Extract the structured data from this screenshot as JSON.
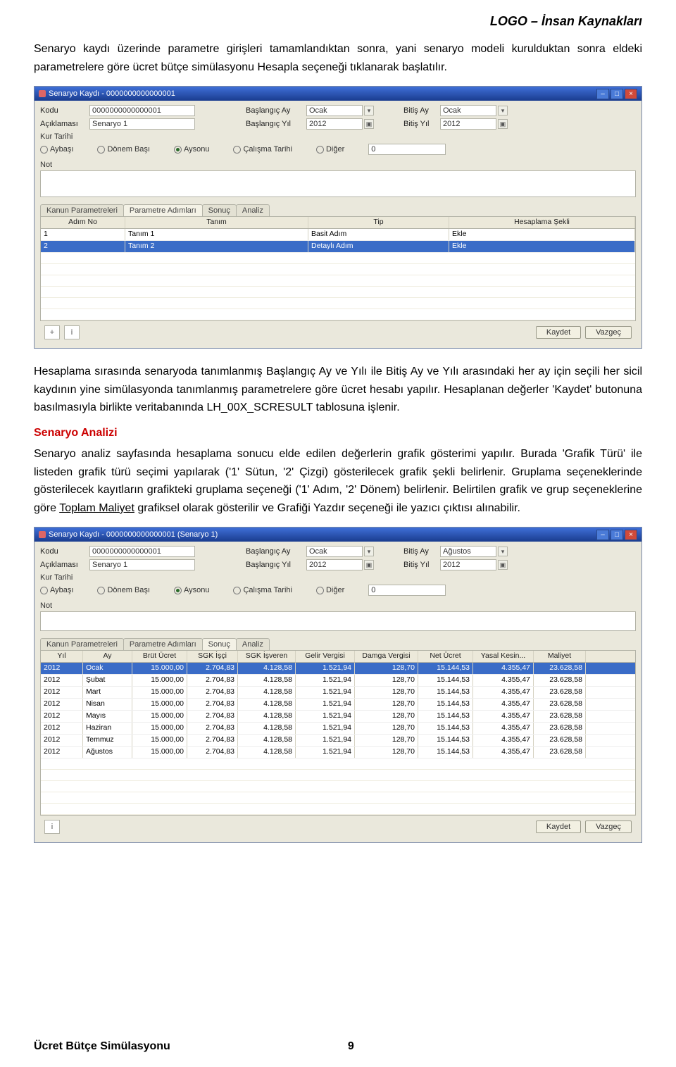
{
  "header": {
    "brand": "LOGO – İnsan Kaynakları"
  },
  "para1": "Senaryo kaydı üzerinde parametre girişleri tamamlandıktan sonra, yani senaryo modeli kurulduktan sonra eldeki parametrelere göre ücret bütçe simülasyonu Hesapla seçeneği tıklanarak başlatılır.",
  "win1": {
    "title": "Senaryo Kaydı - 0000000000000001",
    "fields": {
      "kodu_lbl": "Kodu",
      "kodu_val": "0000000000000001",
      "aciklamasi_lbl": "Açıklaması",
      "aciklamasi_val": "Senaryo 1",
      "bas_ay_lbl": "Başlangıç Ay",
      "bas_ay_val": "Ocak",
      "bas_yil_lbl": "Başlangıç Yıl",
      "bas_yil_val": "2012",
      "bitis_ay_lbl": "Bitiş Ay",
      "bitis_ay_val": "Ocak",
      "bitis_yil_lbl": "Bitiş Yıl",
      "bitis_yil_val": "2012",
      "kur_lbl": "Kur Tarihi",
      "deger_lbl": "",
      "deger_val": "0"
    },
    "radios": {
      "aybasi": "Aybaşı",
      "donem": "Dönem Başı",
      "aysonu": "Aysonu",
      "calisma": "Çalışma Tarihi",
      "diger": "Diğer"
    },
    "not_lbl": "Not",
    "tabs": [
      "Kanun Parametreleri",
      "Parametre Adımları",
      "Sonuç",
      "Analiz"
    ],
    "grid": {
      "cols": [
        "Adım No",
        "Tanım",
        "Tip",
        "Hesaplama Şekli"
      ],
      "rows": [
        {
          "no": "1",
          "tanim": "Tanım 1",
          "tip": "Basit Adım",
          "hes": "Ekle"
        },
        {
          "no": "2",
          "tanim": "Tanım 2",
          "tip": "Detaylı Adım",
          "hes": "Ekle"
        }
      ]
    },
    "buttons": {
      "kaydet": "Kaydet",
      "vazgec": "Vazgeç"
    }
  },
  "para2": "Hesaplama sırasında senaryoda tanımlanmış Başlangıç Ay ve Yılı ile Bitiş Ay ve Yılı arasındaki her ay için seçili her sicil kaydının yine simülasyonda tanımlanmış parametrelere göre ücret hesabı yapılır. Hesaplanan değerler 'Kaydet' butonuna basılmasıyla birlikte veritabanında LH_00X_SCRESULT tablosuna işlenir.",
  "section_title": "Senaryo Analizi",
  "para3_a": "Senaryo analiz sayfasında hesaplama sonucu elde edilen değerlerin grafik gösterimi yapılır. Burada 'Grafik Türü' ile listeden grafik türü seçimi yapılarak ('1' Sütun, '2' Çizgi) gösterilecek grafik şekli belirlenir. Gruplama seçeneklerinde gösterilecek kayıtların grafikteki gruplama seçeneği    ('1' Adım, '2' Dönem) belirlenir. Belirtilen grafik ve grup seçeneklerine göre ",
  "para3_u": "Toplam Maliyet",
  "para3_b": " grafiksel olarak gösterilir ve Grafiği Yazdır seçeneği ile yazıcı çıktısı alınabilir.",
  "win2": {
    "title": "Senaryo Kaydı - 0000000000000001 (Senaryo 1)",
    "fields": {
      "kodu_lbl": "Kodu",
      "kodu_val": "0000000000000001",
      "aciklamasi_lbl": "Açıklaması",
      "aciklamasi_val": "Senaryo 1",
      "bas_ay_lbl": "Başlangıç Ay",
      "bas_ay_val": "Ocak",
      "bas_yil_lbl": "Başlangıç Yıl",
      "bas_yil_val": "2012",
      "bitis_ay_lbl": "Bitiş Ay",
      "bitis_ay_val": "Ağustos",
      "bitis_yil_lbl": "Bitiş Yıl",
      "bitis_yil_val": "2012",
      "kur_lbl": "Kur Tarihi",
      "deger_val": "0"
    },
    "radios": {
      "aybasi": "Aybaşı",
      "donem": "Dönem Başı",
      "aysonu": "Aysonu",
      "calisma": "Çalışma Tarihi",
      "diger": "Diğer"
    },
    "not_lbl": "Not",
    "tabs": [
      "Kanun Parametreleri",
      "Parametre Adımları",
      "Sonuç",
      "Analiz"
    ],
    "grid": {
      "cols": [
        "Yıl",
        "Ay",
        "Brüt Ücret",
        "SGK İşçi",
        "SGK İşveren",
        "Gelir Vergisi",
        "Damga Vergisi",
        "Net Ücret",
        "Yasal Kesin...",
        "Maliyet"
      ],
      "rows": [
        {
          "c": [
            "2012",
            "Ocak",
            "15.000,00",
            "2.704,83",
            "4.128,58",
            "1.521,94",
            "128,70",
            "15.144,53",
            "4.355,47",
            "23.628,58"
          ],
          "sel": true
        },
        {
          "c": [
            "2012",
            "Şubat",
            "15.000,00",
            "2.704,83",
            "4.128,58",
            "1.521,94",
            "128,70",
            "15.144,53",
            "4.355,47",
            "23.628,58"
          ]
        },
        {
          "c": [
            "2012",
            "Mart",
            "15.000,00",
            "2.704,83",
            "4.128,58",
            "1.521,94",
            "128,70",
            "15.144,53",
            "4.355,47",
            "23.628,58"
          ]
        },
        {
          "c": [
            "2012",
            "Nisan",
            "15.000,00",
            "2.704,83",
            "4.128,58",
            "1.521,94",
            "128,70",
            "15.144,53",
            "4.355,47",
            "23.628,58"
          ]
        },
        {
          "c": [
            "2012",
            "Mayıs",
            "15.000,00",
            "2.704,83",
            "4.128,58",
            "1.521,94",
            "128,70",
            "15.144,53",
            "4.355,47",
            "23.628,58"
          ]
        },
        {
          "c": [
            "2012",
            "Haziran",
            "15.000,00",
            "2.704,83",
            "4.128,58",
            "1.521,94",
            "128,70",
            "15.144,53",
            "4.355,47",
            "23.628,58"
          ]
        },
        {
          "c": [
            "2012",
            "Temmuz",
            "15.000,00",
            "2.704,83",
            "4.128,58",
            "1.521,94",
            "128,70",
            "15.144,53",
            "4.355,47",
            "23.628,58"
          ]
        },
        {
          "c": [
            "2012",
            "Ağustos",
            "15.000,00",
            "2.704,83",
            "4.128,58",
            "1.521,94",
            "128,70",
            "15.144,53",
            "4.355,47",
            "23.628,58"
          ]
        }
      ]
    },
    "buttons": {
      "kaydet": "Kaydet",
      "vazgec": "Vazgeç"
    }
  },
  "footer": {
    "left": "Ücret Bütçe Simülasyonu",
    "page": "9"
  }
}
